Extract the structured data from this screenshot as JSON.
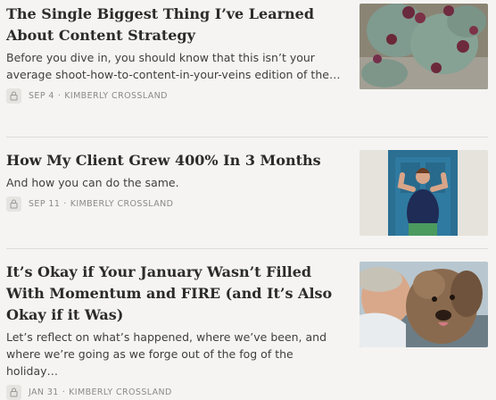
{
  "posts": [
    {
      "title": "The Single Biggest Thing I’ve Learned About Content Strategy",
      "subtitle": "Before you dive in, you should know that this isn’t your average shoot-how-to-content-in-your-veins edition of the…",
      "date": "SEP 4",
      "author": "KIMBERLY CROSSLAND",
      "thumb_icon": "cactus-photo"
    },
    {
      "title": "How My Client Grew 400% In 3 Months",
      "subtitle": "And how you can do the same.",
      "date": "SEP 11",
      "author": "KIMBERLY CROSSLAND",
      "thumb_icon": "woman-flexing-photo"
    },
    {
      "title": "It’s Okay if Your January Wasn’t Filled With Momentum and FIRE (and It’s Also Okay if it Was)",
      "subtitle": "Let’s reflect on what’s happened, where we’ve been, and where we’re going as we forge out of the fog of the holiday…",
      "date": "JAN 31",
      "author": "KIMBERLY CROSSLAND",
      "thumb_icon": "woman-with-dog-photo"
    }
  ],
  "meta_separator": "·",
  "lock_icon": "lock-icon"
}
